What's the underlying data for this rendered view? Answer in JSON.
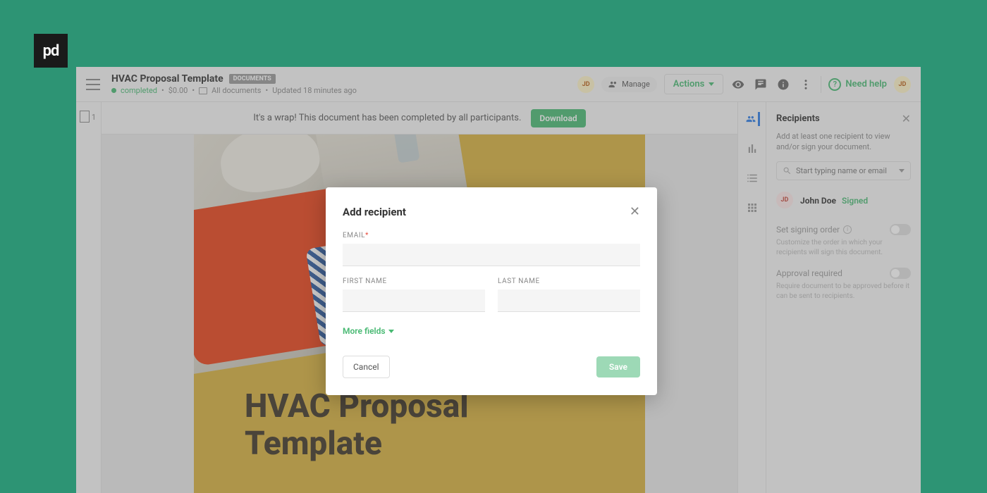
{
  "logo_text": "pd",
  "header": {
    "title": "HVAC Proposal Template",
    "badge": "DOCUMENTS",
    "status": "completed",
    "price": "$0.00",
    "folder": "All documents",
    "updated": "Updated 18 minutes ago",
    "avatar_initials": "JD",
    "manage": "Manage",
    "actions": "Actions",
    "need_help": "Need help"
  },
  "banner": {
    "text": "It's a wrap! This document has been completed by all participants.",
    "download": "Download"
  },
  "left_rail": {
    "page_count": "1"
  },
  "document": {
    "heading_line1": "HVAC Proposal",
    "heading_line2": "Template"
  },
  "panel": {
    "title": "Recipients",
    "subtitle": "Add at least one recipient to view and/or sign your document.",
    "search_placeholder": "Start typing name or email",
    "recipient": {
      "initials": "JD",
      "name": "John Doe",
      "status": "Signed"
    },
    "signing_order": {
      "label": "Set signing order",
      "desc": "Customize the order in which your recipients will sign this document."
    },
    "approval": {
      "label": "Approval required",
      "desc": "Require document to be approved before it can be sent to recipients."
    }
  },
  "modal": {
    "title": "Add recipient",
    "email_label": "EMAIL",
    "first_name_label": "FIRST NAME",
    "last_name_label": "LAST NAME",
    "more_fields": "More fields",
    "cancel": "Cancel",
    "save": "Save"
  }
}
